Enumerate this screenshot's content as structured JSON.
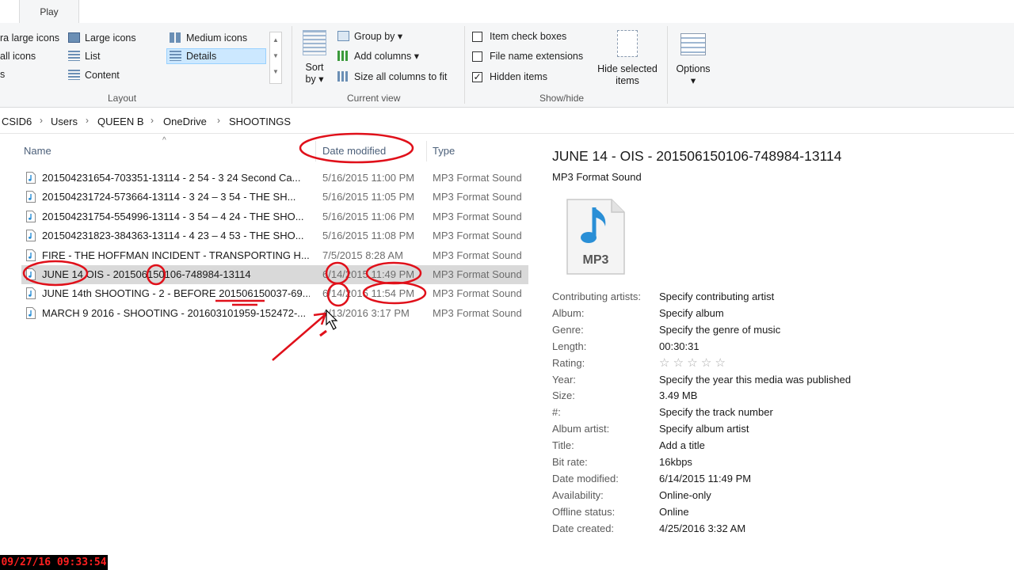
{
  "ribbon": {
    "tab": "Play",
    "layout": {
      "items": [
        "ra large icons",
        "Large icons",
        "Medium icons",
        "all icons",
        "List",
        "Details",
        "s",
        "Content"
      ],
      "label": "Layout"
    },
    "current_view": {
      "sort_by": "Sort",
      "sort_by2": "by",
      "group_by": "Group by",
      "add_columns": "Add columns",
      "size_columns": "Size all columns to fit",
      "label": "Current view"
    },
    "show_hide": {
      "item_check_boxes": "Item check boxes",
      "file_name_extensions": "File name extensions",
      "hidden_items": "Hidden items",
      "hide_selected_1": "Hide selected",
      "hide_selected_2": "items",
      "label": "Show/hide"
    },
    "options": "Options"
  },
  "breadcrumb": [
    "CSID6",
    "Users",
    "QUEEN B",
    "OneDrive",
    "SHOOTINGS"
  ],
  "columns": {
    "name": "Name",
    "date": "Date modified",
    "type": "Type"
  },
  "files": [
    {
      "name": "201504231654-703351-13114 - 2 54  -  3 24  Second Ca...",
      "date": "5/16/2015 11:00 PM",
      "type": "MP3 Format Sound"
    },
    {
      "name": "201504231724-573664-13114   -  3 24 – 3 54 - THE SH...",
      "date": "5/16/2015 11:05 PM",
      "type": "MP3 Format Sound"
    },
    {
      "name": "201504231754-554996-13114 - 3 54 – 4 24 - THE SHO...",
      "date": "5/16/2015 11:06 PM",
      "type": "MP3 Format Sound"
    },
    {
      "name": "201504231823-384363-13114  - 4 23 – 4 53 - THE SHO...",
      "date": "5/16/2015 11:08 PM",
      "type": "MP3 Format Sound"
    },
    {
      "name": "FIRE - THE HOFFMAN INCIDENT - TRANSPORTING H...",
      "date": "7/5/2015 8:28 AM",
      "type": "MP3 Format Sound"
    },
    {
      "name": "JUNE 14   OIS - 201506150106-748984-13114",
      "date": "6/14/2015 11:49 PM",
      "type": "MP3 Format Sound"
    },
    {
      "name": "JUNE 14th SHOOTING - 2 - BEFORE 201506150037-69...",
      "date": "6/14/2015 11:54 PM",
      "type": "MP3 Format Sound"
    },
    {
      "name": "MARCH 9 2016 - SHOOTING - 201603101959-152472-...",
      "date": "4/13/2016 3:17 PM",
      "type": "MP3 Format Sound"
    }
  ],
  "details": {
    "title": "JUNE 14 - OIS - 201506150106-748984-13114",
    "subtitle": "MP3 Format Sound",
    "icon_label": "MP3",
    "props": [
      {
        "label": "Contributing artists:",
        "value": "Specify contributing artist"
      },
      {
        "label": "Album:",
        "value": "Specify album"
      },
      {
        "label": "Genre:",
        "value": "Specify the genre of music"
      },
      {
        "label": "Length:",
        "value": "00:30:31"
      },
      {
        "label": "Rating:",
        "value": "☆ ☆ ☆ ☆ ☆"
      },
      {
        "label": "Year:",
        "value": "Specify the year this media was published"
      },
      {
        "label": "Size:",
        "value": "3.49 MB"
      },
      {
        "label": "#:",
        "value": "Specify the track number"
      },
      {
        "label": "Album artist:",
        "value": "Specify album artist"
      },
      {
        "label": "Title:",
        "value": "Add a title"
      },
      {
        "label": "Bit rate:",
        "value": "16kbps"
      },
      {
        "label": "Date modified:",
        "value": "6/14/2015 11:49 PM"
      },
      {
        "label": "Availability:",
        "value": "Online-only"
      },
      {
        "label": "Offline status:",
        "value": "Online"
      },
      {
        "label": "Date created:",
        "value": "4/25/2016 3:32 AM"
      }
    ]
  },
  "timestamp": "09/27/16 09:33:54",
  "colors": {
    "annotation": "#e0101a",
    "selected_row": "#d9d9d9",
    "header_text": "#4c607a",
    "mp3_icon": "#2a8fd6"
  }
}
